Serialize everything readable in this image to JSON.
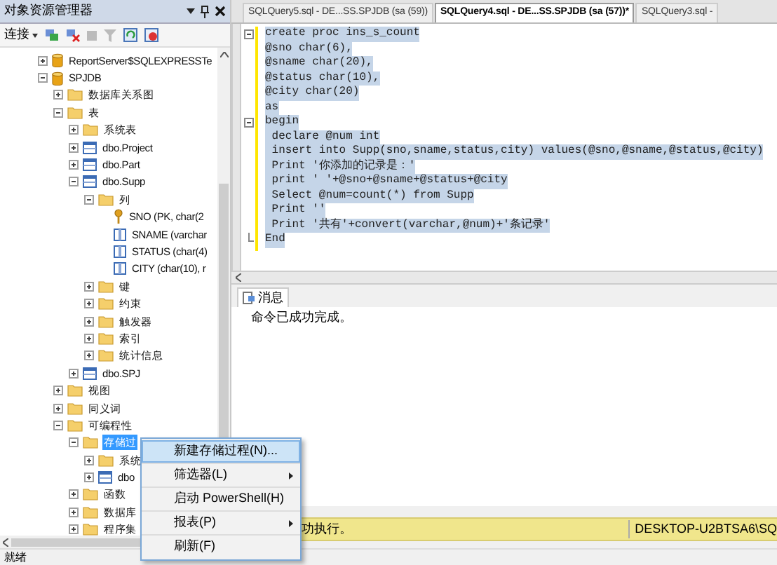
{
  "object_explorer": {
    "title": "对象资源管理器",
    "connect": "连接",
    "tree": [
      {
        "label": "ReportServer$SQLEXPRESSTe",
        "kind": "database",
        "expanded": false,
        "selected": false
      },
      {
        "label": "SPJDB",
        "kind": "database",
        "expanded": true,
        "selected": false,
        "children": [
          {
            "label": "数据库关系图",
            "kind": "folder",
            "expanded": false,
            "selected": false
          },
          {
            "label": "表",
            "kind": "folder",
            "expanded": true,
            "selected": false,
            "children": [
              {
                "label": "系统表",
                "kind": "folder",
                "expanded": false,
                "selected": false
              },
              {
                "label": "dbo.Project",
                "kind": "table",
                "expanded": false,
                "selected": false
              },
              {
                "label": "dbo.Part",
                "kind": "table",
                "expanded": false,
                "selected": false
              },
              {
                "label": "dbo.Supp",
                "kind": "table",
                "expanded": true,
                "selected": false,
                "children": [
                  {
                    "label": "列",
                    "kind": "folder",
                    "expanded": true,
                    "selected": false,
                    "children": [
                      {
                        "label": "SNO (PK, char(2",
                        "kind": "key",
                        "selected": false
                      },
                      {
                        "label": "SNAME (varchar",
                        "kind": "column",
                        "selected": false
                      },
                      {
                        "label": "STATUS (char(4)",
                        "kind": "column",
                        "selected": false
                      },
                      {
                        "label": "CITY (char(10), r",
                        "kind": "column",
                        "selected": false
                      }
                    ]
                  },
                  {
                    "label": "键",
                    "kind": "folder",
                    "expanded": false,
                    "selected": false
                  },
                  {
                    "label": "约束",
                    "kind": "folder",
                    "expanded": false,
                    "selected": false
                  },
                  {
                    "label": "触发器",
                    "kind": "folder",
                    "expanded": false,
                    "selected": false
                  },
                  {
                    "label": "索引",
                    "kind": "folder",
                    "expanded": false,
                    "selected": false
                  },
                  {
                    "label": "统计信息",
                    "kind": "folder",
                    "expanded": false,
                    "selected": false
                  }
                ]
              },
              {
                "label": "dbo.SPJ",
                "kind": "table",
                "expanded": false,
                "selected": false
              }
            ]
          },
          {
            "label": "视图",
            "kind": "folder",
            "expanded": false,
            "selected": false
          },
          {
            "label": "同义词",
            "kind": "folder",
            "expanded": false,
            "selected": false
          },
          {
            "label": "可编程性",
            "kind": "folder",
            "expanded": true,
            "selected": false,
            "children": [
              {
                "label": "存储过",
                "kind": "folder",
                "expanded": true,
                "selected": true,
                "children": [
                  {
                    "label": "系统",
                    "kind": "folder",
                    "expanded": false,
                    "selected": false
                  },
                  {
                    "label": "dbo",
                    "kind": "procedure",
                    "expanded": false,
                    "selected": false
                  }
                ]
              },
              {
                "label": "函数",
                "kind": "folder",
                "expanded": false,
                "selected": false
              },
              {
                "label": "数据库",
                "kind": "folder",
                "expanded": false,
                "selected": false
              },
              {
                "label": "程序集",
                "kind": "folder",
                "expanded": false,
                "selected": false
              }
            ]
          }
        ]
      }
    ]
  },
  "tabs": [
    {
      "label": "SQLQuery5.sql - DE...SS.SPJDB (sa (59))",
      "selected": false
    },
    {
      "label": "SQLQuery4.sql - DE...SS.SPJDB (sa (57))*",
      "selected": true
    },
    {
      "label": "SQLQuery3.sql -",
      "selected": false
    }
  ],
  "editor": {
    "lines": [
      {
        "text": "create proc ins_s_count",
        "kind": "fold-start"
      },
      {
        "text": "@sno char(6),",
        "kind": "plain"
      },
      {
        "text": "@sname char(20),",
        "kind": "plain"
      },
      {
        "text": "@status char(10),",
        "kind": "plain"
      },
      {
        "text": "@city char(20)",
        "kind": "plain"
      },
      {
        "text": "as",
        "kind": "plain"
      },
      {
        "text": "begin",
        "kind": "fold-start"
      },
      {
        "text": " declare @num int",
        "kind": "plain"
      },
      {
        "text": " insert into Supp(sno,sname,status,city) values(@sno,@sname,@status,@city)",
        "kind": "plain"
      },
      {
        "text": " Print '你添加的记录是：'",
        "kind": "plain"
      },
      {
        "text": " print ' '+@sno+@sname+@status+@city",
        "kind": "plain"
      },
      {
        "text": " Select @num=count(*) from Supp",
        "kind": "plain"
      },
      {
        "text": " Print ''",
        "kind": "plain"
      },
      {
        "text": " Print '共有'+convert(varchar,@num)+'条记录'",
        "kind": "plain"
      },
      {
        "text": "End",
        "kind": "fold-end"
      }
    ]
  },
  "results": {
    "tab": "消息",
    "message": "命令已成功完成。"
  },
  "query_status": {
    "message": "功执行。",
    "server": "DESKTOP-U2BTSA6\\SQ"
  },
  "context_menu": {
    "items": [
      {
        "label": "新建存储过程(N)...",
        "selected": true,
        "submenu": false
      },
      {
        "label": "筛选器(L)",
        "selected": false,
        "submenu": true
      },
      {
        "label": "启动 PowerShell(H)",
        "selected": false,
        "submenu": false
      },
      {
        "label": "报表(P)",
        "selected": false,
        "submenu": true
      },
      {
        "label": "刷新(F)",
        "selected": false,
        "submenu": false
      }
    ]
  },
  "status_bar": "就绪"
}
